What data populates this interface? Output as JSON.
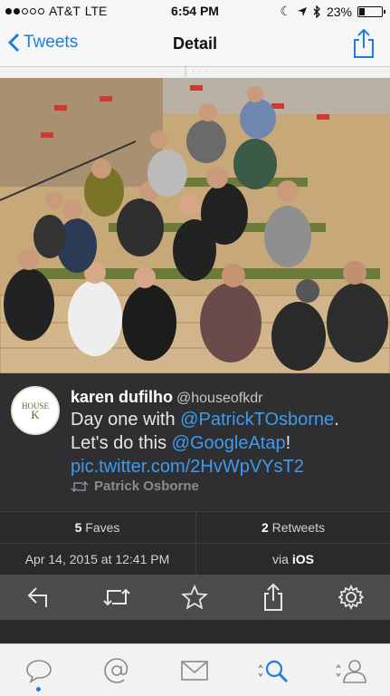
{
  "status": {
    "carrier": "AT&T",
    "network": "LTE",
    "time": "6:54 PM",
    "battery": "23%",
    "battery_level": 0.23
  },
  "nav": {
    "back_label": "Tweets",
    "title": "Detail"
  },
  "tweet": {
    "display_name": "karen dufilho",
    "handle": "@houseofkdr",
    "avatar_text": [
      "HOUSE",
      "K"
    ],
    "text_1": "Day one with ",
    "mention_1": "@PatrickTOsborne",
    "text_2": ".",
    "text_3": "Let's do this ",
    "mention_2": "@GoogleAtap",
    "text_4": "!",
    "link": "pic.twitter.com/2HvWpVYsT2",
    "retweeted_by": "Patrick Osborne"
  },
  "stats": {
    "faves_count": "5",
    "faves_label": "Faves",
    "retweets_count": "2",
    "retweets_label": "Retweets"
  },
  "meta": {
    "timestamp": "Apr 14, 2015 at 12:41 PM",
    "via_prefix": "via",
    "client": "iOS"
  },
  "actions": [
    "reply-icon",
    "retweet-icon",
    "favorite-icon",
    "share-icon",
    "settings-icon"
  ],
  "tabs": [
    "timeline-icon",
    "mentions-icon",
    "messages-icon",
    "search-icon",
    "profile-icon"
  ],
  "colors": {
    "accent": "#1b7fe0",
    "link": "#3d9bf0"
  }
}
